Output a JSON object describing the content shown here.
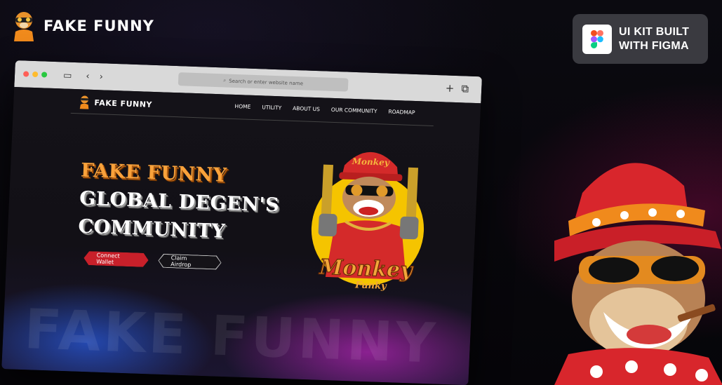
{
  "brand": {
    "name": "FAKE FUNNY"
  },
  "badge": {
    "line1": "UI KIT BUILT",
    "line2": "WITH FIGMA"
  },
  "browser": {
    "url_placeholder": "Search or enter website name",
    "site": {
      "brand": "FAKE FUNNY",
      "nav": [
        "HOME",
        "UTILITY",
        "ABOUT US",
        "OUR COMMUNITY",
        "ROADMAP"
      ],
      "hero_line1": "FAKE FUNNY",
      "hero_line2": "GLOBAL DEGEN'S",
      "hero_line3": "COMMUNITY",
      "connect_wallet": "Connect Wallet",
      "claim_airdrop": "Claim Airdrop",
      "ghost_text": "FAKE FUNNY",
      "mascot_logo": "Monkey",
      "mascot_logo_sub": "Funky"
    }
  },
  "colors": {
    "accent_orange": "#f9a23b",
    "accent_red": "#c8202a",
    "badge_bg": "#3a3a40"
  }
}
